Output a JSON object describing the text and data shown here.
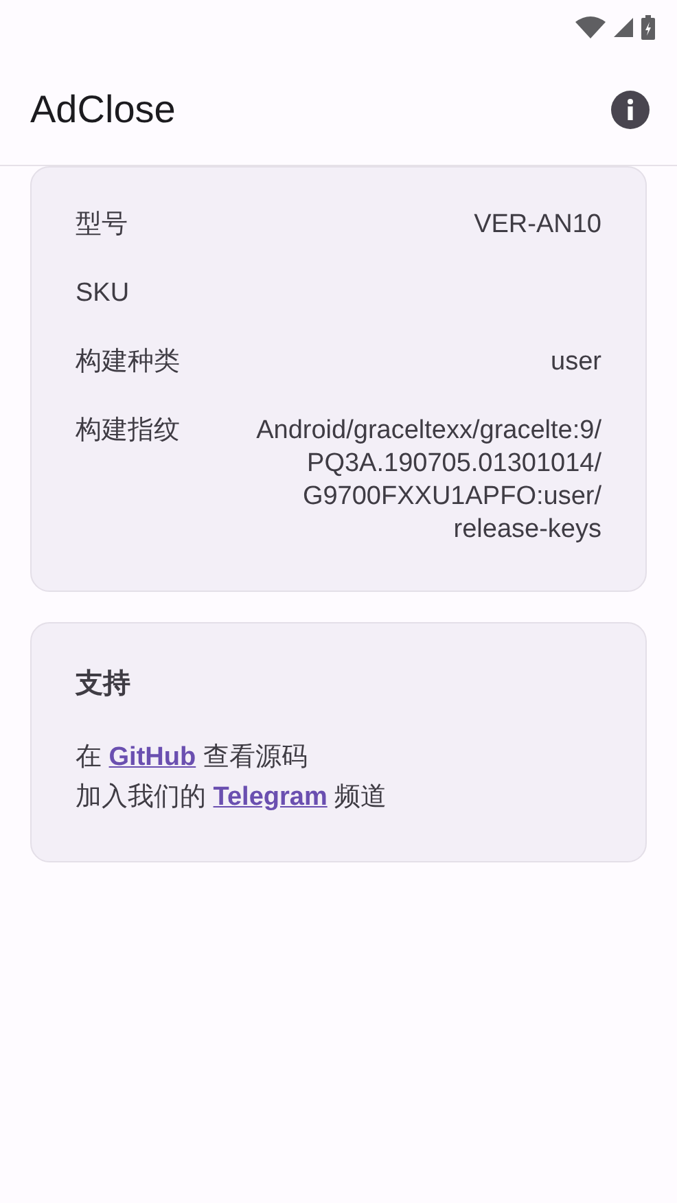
{
  "app_bar": {
    "title": "AdClose"
  },
  "device_info": {
    "rows": [
      {
        "label": "型号",
        "value": "VER-AN10"
      },
      {
        "label": "SKU",
        "value": ""
      },
      {
        "label": "构建种类",
        "value": "user"
      },
      {
        "label": "构建指纹",
        "value": "Android/graceltexx/gracelte:9/PQ3A.190705.01301014/G9700FXXU1APFO:user/release-keys"
      }
    ]
  },
  "support": {
    "title": "支持",
    "lines": [
      {
        "before": "在 ",
        "link": "GitHub",
        "after": " 查看源码"
      },
      {
        "before": "加入我们的 ",
        "link": "Telegram",
        "after": " 频道"
      }
    ]
  }
}
